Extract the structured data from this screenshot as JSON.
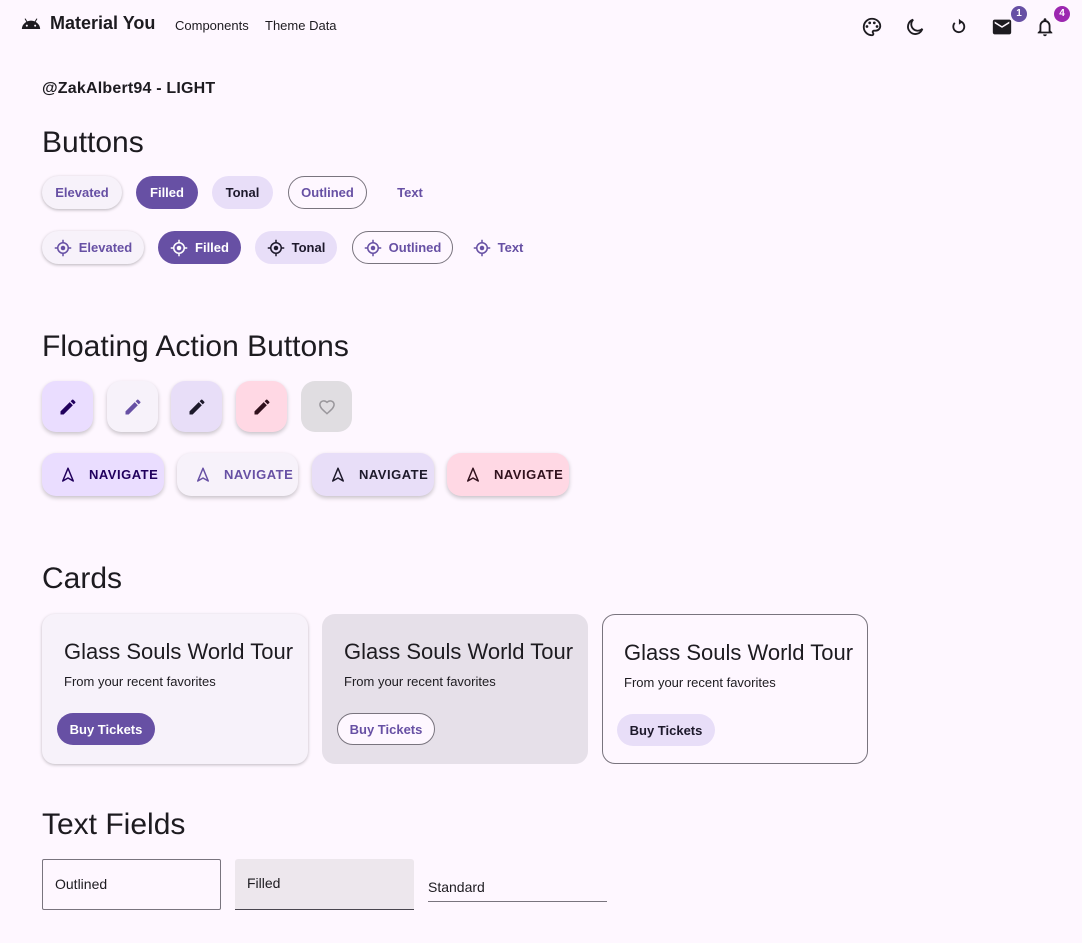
{
  "appbar": {
    "title": "Material You",
    "nav": [
      "Components",
      "Theme Data"
    ],
    "actions": [
      {
        "icon": "palette-icon"
      },
      {
        "icon": "dark-mode-icon"
      },
      {
        "icon": "refresh-icon"
      },
      {
        "icon": "mail-icon",
        "badge": "1"
      },
      {
        "icon": "notifications-icon",
        "badge": "4"
      }
    ]
  },
  "subtitle": "@ZakAlbert94 - LIGHT",
  "sections": {
    "buttons": "Buttons",
    "fabs": "Floating Action Buttons",
    "cards": "Cards",
    "text_fields": "Text Fields"
  },
  "buttons": {
    "row1": [
      "Elevated",
      "Filled",
      "Tonal",
      "Outlined",
      "Text"
    ],
    "row2": [
      "Elevated",
      "Filled",
      "Tonal",
      "Outlined",
      "Text"
    ],
    "row2_icon": "gps-fixed-icon"
  },
  "fabs": {
    "small_icons": [
      "edit-icon",
      "edit-icon",
      "edit-icon",
      "edit-icon",
      "favorite-icon"
    ],
    "extended_label": "NAVIGATE",
    "extended_icon": "navigation-icon"
  },
  "cards": [
    {
      "title": "Glass Souls World Tour",
      "subtitle": "From your recent favorites",
      "button": "Buy Tickets"
    },
    {
      "title": "Glass Souls World Tour",
      "subtitle": "From your recent favorites",
      "button": "Buy Tickets"
    },
    {
      "title": "Glass Souls World Tour",
      "subtitle": "From your recent favorites",
      "button": "Buy Tickets"
    }
  ],
  "text_fields": {
    "outlined": "Outlined",
    "filled": "Filled",
    "standard": "Standard"
  },
  "colors": {
    "primary": "#6750a4",
    "background": "#fef7ff",
    "secondary_container": "#e8def8",
    "tertiary_container": "#ffd8e4",
    "primary_container": "#eaddff"
  }
}
